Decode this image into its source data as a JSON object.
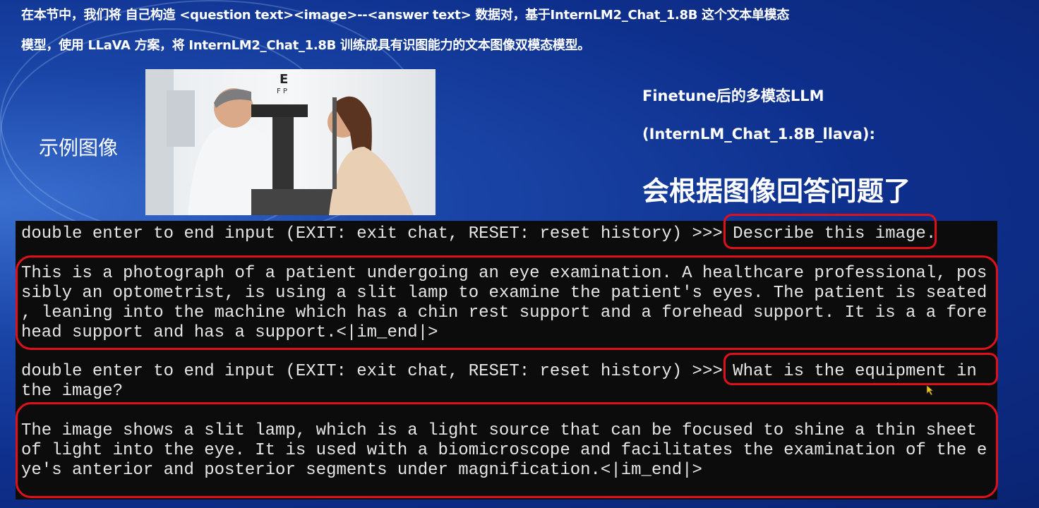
{
  "intro": {
    "line1": "在本节中，我们将 自己构造 <question text><image>--<answer text> 数据对，基于InternLM2_Chat_1.8B 这个文本单模态",
    "line2": "模型，使用 LLaVA 方案，将 InternLM2_Chat_1.8B 训练成具有识图能力的文本图像双模态模型。"
  },
  "example_label": "示例图像",
  "right": {
    "title": "Finetune后的多模态LLM",
    "model": "(InternLM_Chat_1.8B_llava):",
    "headline": "会根据图像回答问题了"
  },
  "terminal": {
    "prompt1": "double enter to end input (EXIT: exit chat, RESET: reset history) >>> ",
    "query1": "Describe this image.",
    "answer1": [
      "This is a photograph of a patient undergoing an eye examination. A healthcare professional, pos",
      "sibly an optometrist, is using a slit lamp to examine the patient's eyes. The patient is seated",
      ", leaning into the machine which has a chin rest support and a forehead support. It is a a fore",
      "head support and has a support.<|im_end|>"
    ],
    "prompt2": "double enter to end input (EXIT: exit chat, RESET: reset history) >>> ",
    "query2a": "What is the equipment in",
    "query2b": "the image?",
    "answer2": [
      "The image shows a slit lamp, which is a light source that can be focused to shine a thin sheet",
      "of light into the eye. It is used with a biomicroscope and facilitates the examination of the e",
      "ye's anterior and posterior segments under magnification.<|im_end|>"
    ]
  }
}
